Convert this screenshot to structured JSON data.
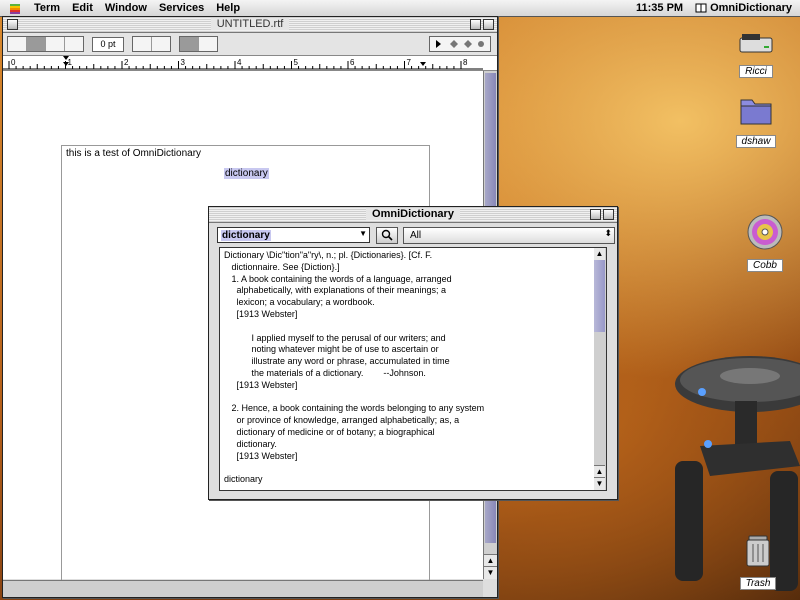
{
  "menubar": {
    "items": [
      "Term",
      "Edit",
      "Window",
      "Services",
      "Help"
    ],
    "clock": "11:35 PM",
    "app_name": "OmniDictionary"
  },
  "doc_window": {
    "title": "UNTITLED.rtf",
    "font_size": "0 pt",
    "ruler_numbers": [
      "0",
      "1",
      "2",
      "3",
      "4",
      "5",
      "6",
      "7",
      "8"
    ],
    "page_text": "this is a test of OmniDictionary",
    "selected_word": "dictionary"
  },
  "dict_window": {
    "title": "OmniDictionary",
    "search_value": "dictionary",
    "scope": "All",
    "lines": [
      "Dictionary \\Dic\"tion\"a\"ry\\, n.; pl. {Dictionaries}. [Cf. F.",
      "   dictionnaire. See {Diction}.]",
      "   1. A book containing the words of a language, arranged",
      "     alphabetically, with explanations of their meanings; a",
      "     lexicon; a vocabulary; a wordbook.",
      "     [1913 Webster]",
      "",
      "           I applied myself to the perusal of our writers; and",
      "           noting whatever might be of use to ascertain or",
      "           illustrate any word or phrase, accumulated in time",
      "           the materials of a dictionary.        --Johnson.",
      "     [1913 Webster]",
      "",
      "   2. Hence, a book containing the words belonging to any system",
      "     or province of knowledge, arranged alphabetically; as, a",
      "     dictionary of medicine or of botany; a biographical",
      "     dictionary.",
      "     [1913 Webster]",
      "",
      "dictionary"
    ]
  },
  "desktop_icons": [
    {
      "label": "Ricci",
      "icon": "hard-drive-icon"
    },
    {
      "label": "dshaw",
      "icon": "home-folder-icon"
    },
    {
      "label": "Cobb",
      "icon": "cd-icon"
    },
    {
      "label": "Trash",
      "icon": "trash-icon"
    }
  ],
  "colors": {
    "selection": "#c8c8f0",
    "scroll_thumb": "#9898c8"
  }
}
